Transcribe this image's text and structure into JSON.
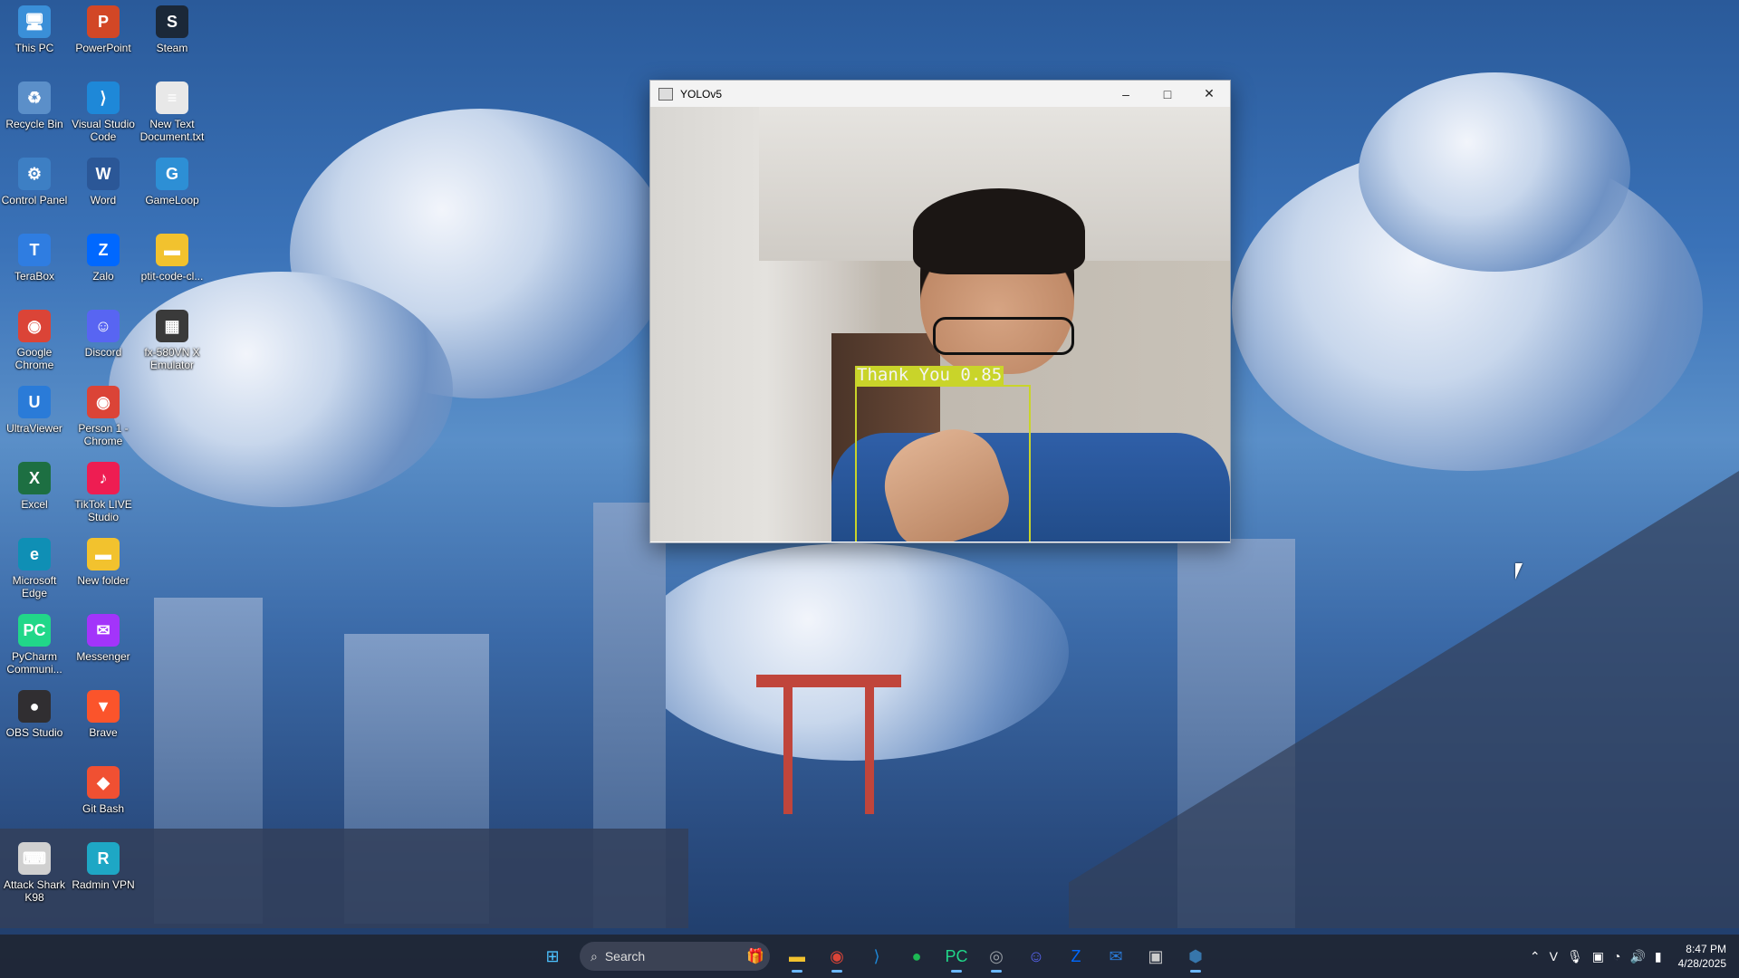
{
  "desktop": {
    "icons": [
      {
        "label": "This PC",
        "glyph": "🖥",
        "color": "#3a8fd8"
      },
      {
        "label": "PowerPoint",
        "glyph": "P",
        "color": "#d24726"
      },
      {
        "label": "Steam",
        "glyph": "S",
        "color": "#1b2838"
      },
      {
        "label": "Recycle Bin",
        "glyph": "♻",
        "color": "#5b8fc9"
      },
      {
        "label": "Visual Studio Code",
        "glyph": "⟩",
        "color": "#1e88d8"
      },
      {
        "label": "New Text Document.txt",
        "glyph": "≡",
        "color": "#e8e8e8"
      },
      {
        "label": "Control Panel",
        "glyph": "⚙",
        "color": "#3d7fc4"
      },
      {
        "label": "Word",
        "glyph": "W",
        "color": "#2b5797"
      },
      {
        "label": "GameLoop",
        "glyph": "G",
        "color": "#2d8fd5"
      },
      {
        "label": "TeraBox",
        "glyph": "T",
        "color": "#2f7de1"
      },
      {
        "label": "Zalo",
        "glyph": "Z",
        "color": "#0068ff"
      },
      {
        "label": "ptit-code-cl...",
        "glyph": "▬",
        "color": "#f2c22e"
      },
      {
        "label": "Google Chrome",
        "glyph": "◉",
        "color": "#db4437"
      },
      {
        "label": "Discord",
        "glyph": "☺",
        "color": "#5865f2"
      },
      {
        "label": "fx-580VN X Emulator",
        "glyph": "▦",
        "color": "#3a3a3a"
      },
      {
        "label": "UltraViewer",
        "glyph": "U",
        "color": "#2a7bd8"
      },
      {
        "label": "Person 1 - Chrome",
        "glyph": "◉",
        "color": "#db4437"
      },
      {
        "label": "Excel",
        "glyph": "X",
        "color": "#1d6f42"
      },
      {
        "label": "TikTok LIVE Studio",
        "glyph": "♪",
        "color": "#ee1d52"
      },
      {
        "label": "Microsoft Edge",
        "glyph": "e",
        "color": "#0f8fb5"
      },
      {
        "label": "New folder",
        "glyph": "▬",
        "color": "#f2c22e"
      },
      {
        "label": "PyCharm Communi...",
        "glyph": "PC",
        "color": "#21d789"
      },
      {
        "label": "Messenger",
        "glyph": "✉",
        "color": "#a334fa"
      },
      {
        "label": "OBS Studio",
        "glyph": "●",
        "color": "#302e31"
      },
      {
        "label": "Brave",
        "glyph": "▼",
        "color": "#fb542b"
      },
      {
        "label": "Git Bash",
        "glyph": "◆",
        "color": "#f05032"
      },
      {
        "label": "Attack Shark K98",
        "glyph": "⌨",
        "color": "#d0d0d0"
      },
      {
        "label": "Radmin VPN",
        "glyph": "R",
        "color": "#1ea7c5"
      }
    ]
  },
  "window": {
    "title": "YOLOv5",
    "detection": {
      "label": "Thank You 0.85",
      "class": "Thank You",
      "confidence": 0.85,
      "box_color": "#c9d42a"
    }
  },
  "taskbar": {
    "search_placeholder": "Search",
    "apps": [
      {
        "name": "start",
        "glyph": "⊞",
        "color": "#4cc2ff"
      },
      {
        "name": "file-explorer",
        "glyph": "▬",
        "color": "#f2c22e"
      },
      {
        "name": "chrome",
        "glyph": "◉",
        "color": "#db4437"
      },
      {
        "name": "vscode",
        "glyph": "⟩",
        "color": "#1e88d8"
      },
      {
        "name": "spotify",
        "glyph": "●",
        "color": "#1db954"
      },
      {
        "name": "pycharm",
        "glyph": "PC",
        "color": "#21d789"
      },
      {
        "name": "chrome-profile",
        "glyph": "◎",
        "color": "#9aa0a6"
      },
      {
        "name": "discord",
        "glyph": "☺",
        "color": "#5865f2"
      },
      {
        "name": "zalo",
        "glyph": "Z",
        "color": "#0068ff"
      },
      {
        "name": "mail",
        "glyph": "✉",
        "color": "#2a7bd8"
      },
      {
        "name": "terminal",
        "glyph": "▣",
        "color": "#cccccc"
      },
      {
        "name": "python",
        "glyph": "⬢",
        "color": "#3776ab"
      }
    ],
    "tray": {
      "time": "8:47 PM",
      "date": "4/28/2025"
    }
  }
}
